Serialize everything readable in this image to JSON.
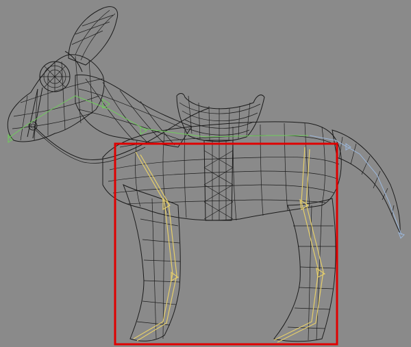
{
  "scene": {
    "background": "#8a8a8a",
    "wire_color": "#1a1a1a",
    "selection_color": "#e00000",
    "bone_colors": {
      "spine_head": "#6fcf5a",
      "legs": "#e6cf6a",
      "tail": "#9ab4d6"
    }
  }
}
